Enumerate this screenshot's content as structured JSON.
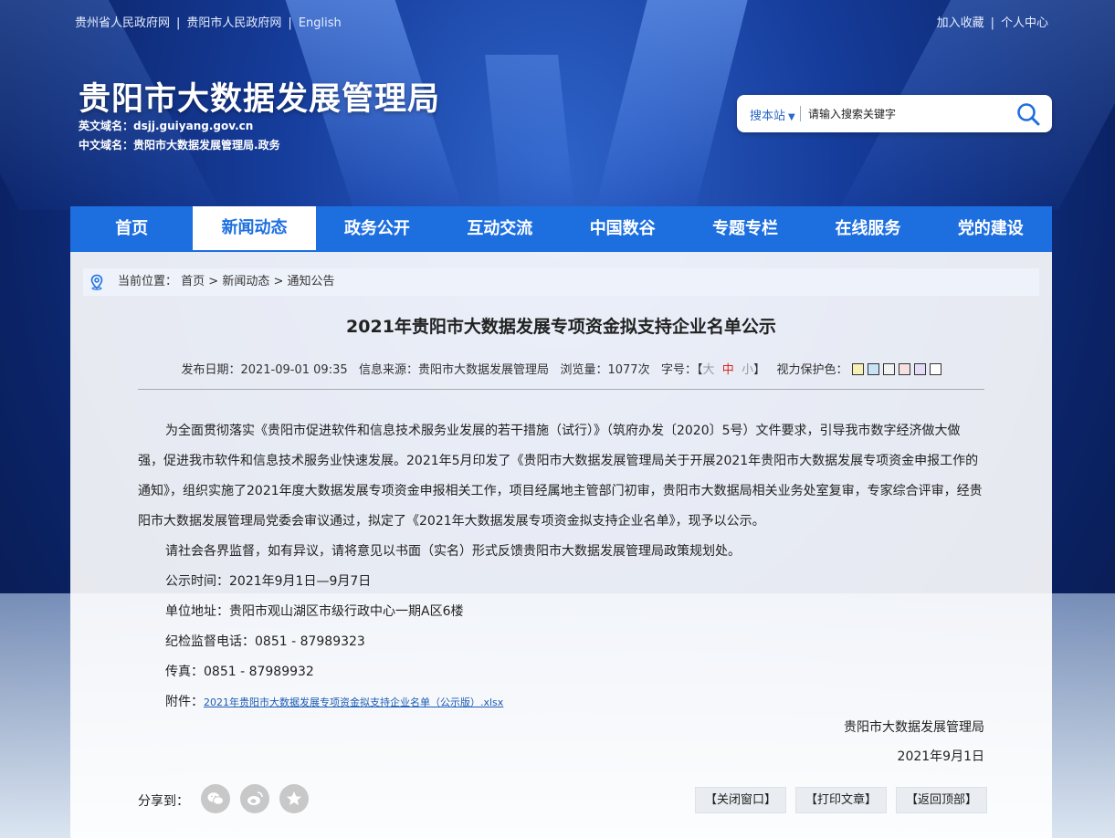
{
  "topbar": {
    "left_links": [
      "贵州省人民政府网",
      "贵阳市人民政府网",
      "English"
    ],
    "right_links": [
      "加入收藏",
      "个人中心"
    ]
  },
  "site": {
    "title": "贵阳市大数据发展管理局",
    "en_domain_label": "英文域名：",
    "en_domain": "dsjj.guiyang.gov.cn",
    "cn_domain_label": "中文域名：",
    "cn_domain": "贵阳市大数据发展管理局.政务"
  },
  "search": {
    "scope": "搜本站",
    "placeholder": "请输入搜索关键字"
  },
  "nav": {
    "items": [
      "首页",
      "新闻动态",
      "政务公开",
      "互动交流",
      "中国数谷",
      "专题专栏",
      "在线服务",
      "党的建设"
    ],
    "active": "新闻动态"
  },
  "breadcrumb": {
    "label": "当前位置：",
    "path": "首页 > 新闻动态 > 通知公告"
  },
  "article": {
    "title": "2021年贵阳市大数据发展专项资金拟支持企业名单公示",
    "meta": {
      "date_label": "发布日期：",
      "date": "2021-09-01 09:35",
      "source_label": "信息来源：",
      "source": "贵阳市大数据发展管理局",
      "views_label": "浏览量：",
      "views": "1077次",
      "fontsize_label": "字号：",
      "fs_big": "大",
      "fs_mid": "中",
      "fs_small": "小",
      "eye_label": "视力保护色："
    },
    "swatch_colors": [
      "#f7f0b4",
      "#c6e4f5",
      "#f2f2f2",
      "#f7e0e0",
      "#e4dcf5",
      "#ffffff"
    ],
    "paragraph1": "为全面贯彻落实《贵阳市促进软件和信息技术服务业发展的若干措施（试行）》（筑府办发〔2020〕5号）文件要求，引导我市数字经济做大做强，促进我市软件和信息技术服务业快速发展。2021年5月印发了《贵阳市大数据发展管理局关于开展2021年贵阳市大数据发展专项资金申报工作的通知》，组织实施了2021年度大数据发展专项资金申报相关工作，项目经属地主管部门初审，贵阳市大数据局相关业务处室复审，专家综合评审，经贵阳市大数据发展管理局党委会审议通过，拟定了《2021年大数据发展专项资金拟支持企业名单》，现予以公示。",
    "paragraph2": "请社会各界监督，如有异议，请将意见以书面（实名）形式反馈贵阳市大数据发展管理局政策规划处。",
    "period": "公示时间：2021年9月1日—9月7日",
    "address": "单位地址：贵阳市观山湖区市级行政中心一期A区6楼",
    "phone": "纪检监督电话：0851 - 87989323",
    "fax": "传真：0851 - 87989932",
    "attachment_label": "附件：",
    "attachment": "2021年贵阳市大数据发展专项资金拟支持企业名单（公示版）.xlsx",
    "sign_org": "贵阳市大数据发展管理局",
    "sign_date": "2021年9月1日"
  },
  "footer": {
    "share_label": "分享到：",
    "close": "【关闭窗口】",
    "print": "【打印文章】",
    "top": "【返回顶部】"
  }
}
